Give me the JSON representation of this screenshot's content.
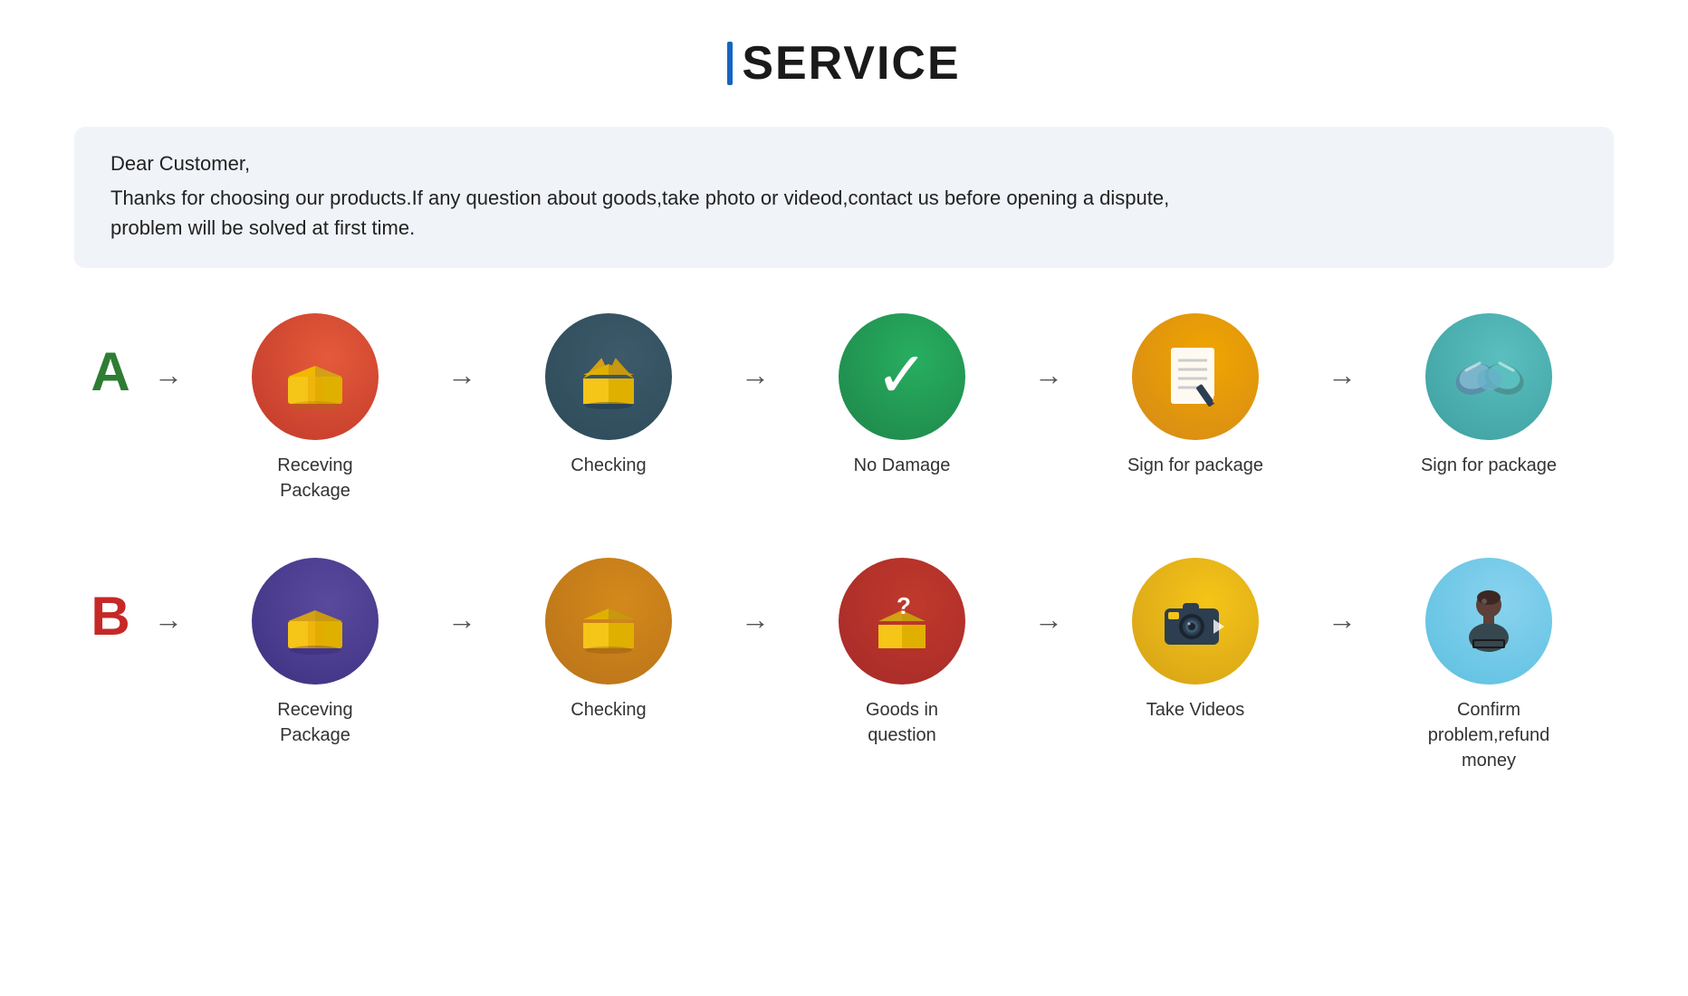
{
  "header": {
    "bar_color": "#1565C0",
    "title": "SERVICE"
  },
  "notice": {
    "line1": "Dear Customer,",
    "line2": "Thanks for choosing our products.If any question about goods,take photo or videod,contact us before opening a dispute,",
    "line3": "problem will be solved at first time."
  },
  "row_a": {
    "letter": "A",
    "letter_color": "green",
    "items": [
      {
        "label": "Receving Package"
      },
      {
        "label": "Checking"
      },
      {
        "label": "No Damage"
      },
      {
        "label": "Sign for package"
      },
      {
        "label": "Sign for package"
      }
    ]
  },
  "row_b": {
    "letter": "B",
    "letter_color": "red",
    "items": [
      {
        "label": "Receving Package"
      },
      {
        "label": "Checking"
      },
      {
        "label": "Goods in question"
      },
      {
        "label": "Take Videos"
      },
      {
        "label": "Confirm  problem,refund money"
      }
    ]
  },
  "arrow": "→"
}
